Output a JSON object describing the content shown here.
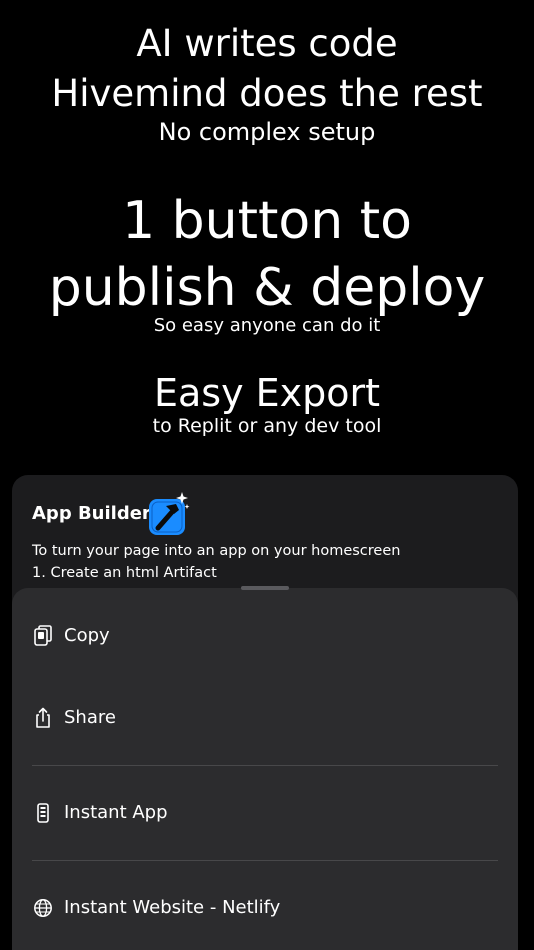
{
  "hero": {
    "line1": "AI writes code",
    "line2": "Hivemind does the rest",
    "line3": "No complex setup",
    "line4": "1 button to",
    "line5": "publish & deploy",
    "line6": "So easy anyone can do it",
    "line7": "Easy Export",
    "line8": "to Replit or any dev tool"
  },
  "card": {
    "title": "App Builder",
    "icon": "hammer-sparkle-icon",
    "description": "To turn your page into an app on your homescreen",
    "step1": "1. Create an html Artifact"
  },
  "sheet": {
    "items": [
      {
        "label": "Copy",
        "icon": "copy-icon"
      },
      {
        "label": "Share",
        "icon": "share-icon"
      },
      {
        "label": "Instant App",
        "icon": "phone-icon"
      },
      {
        "label": "Instant Website - Netlify",
        "icon": "globe-icon"
      }
    ]
  },
  "colors": {
    "background": "#000000",
    "card": "#1c1c1e",
    "sheet": "#2c2c2e",
    "app_icon_blue": "#1a8cff"
  }
}
